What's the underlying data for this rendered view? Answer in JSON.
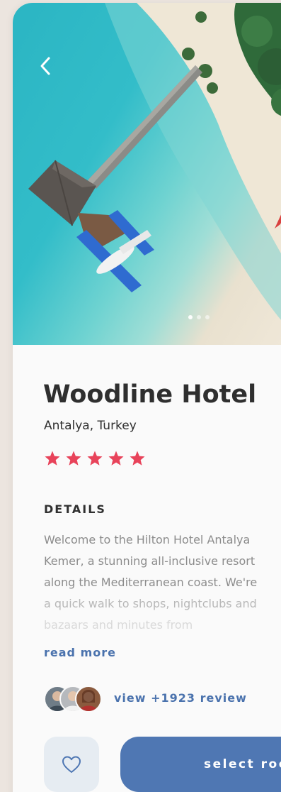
{
  "hotel": {
    "name": "Woodline Hotel",
    "location": "Antalya, Turkey",
    "rating": 5,
    "rating_max": 5
  },
  "details": {
    "heading": "DETAILS",
    "lines": [
      "Welcome to the Hilton Hotel Antalya",
      "Kemer, a stunning all-inclusive resort",
      "along the Mediterranean coast. We're",
      "a quick walk to shops, nightclubs and",
      "bazaars and minutes from"
    ],
    "read_more": "read more"
  },
  "reviews": {
    "label": "view +1923 review"
  },
  "actions": {
    "select_label": "select room"
  },
  "carousel": {
    "total": 3,
    "active": 1
  },
  "icons": {
    "back": "chevron-left-icon",
    "favorite": "heart-icon",
    "star": "star-icon"
  },
  "colors": {
    "accent": "#4f77b3",
    "link": "#4a72ad",
    "star": "#e8435a",
    "favorite_bg": "#e6ecf2",
    "title": "#2f2f2f",
    "body_text": "#8c8c8c"
  }
}
